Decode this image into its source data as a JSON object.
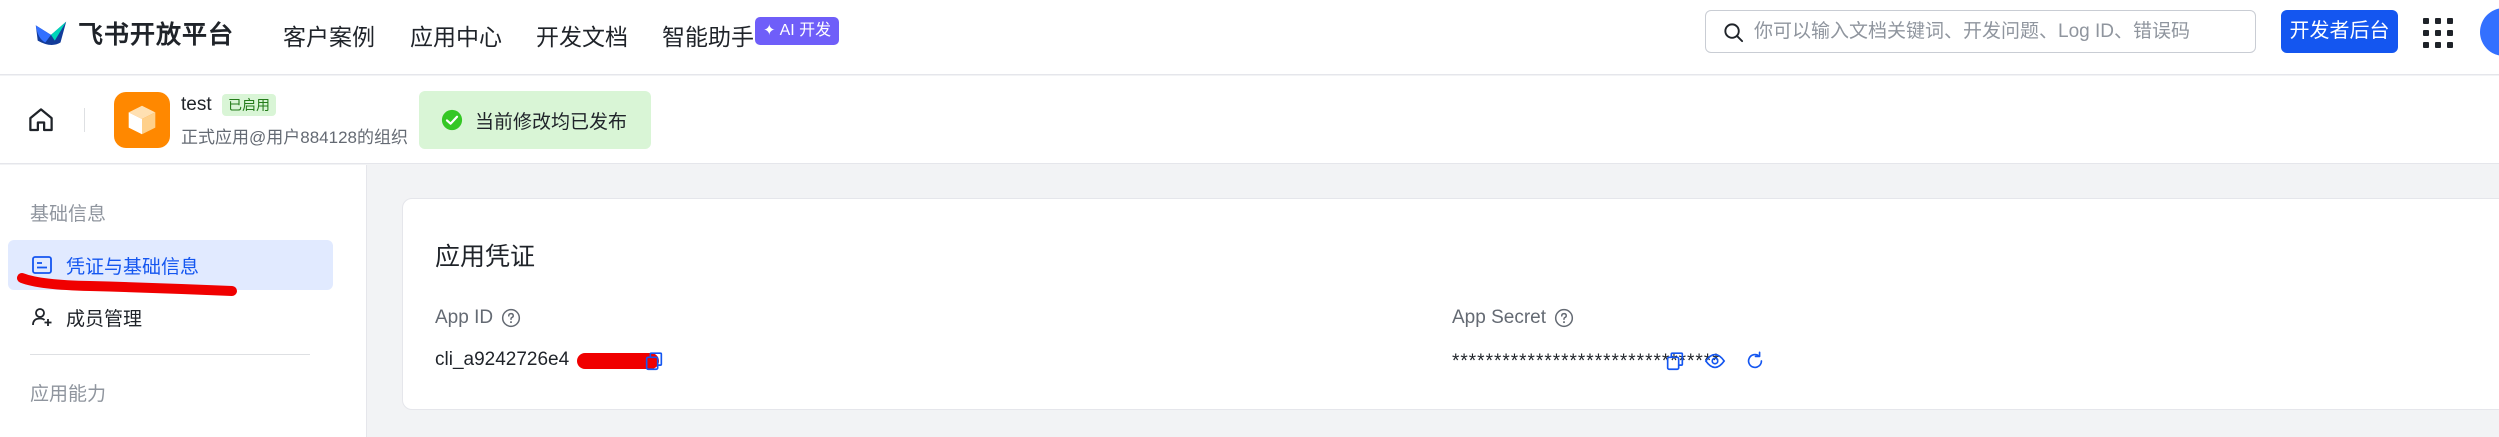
{
  "brand": {
    "name": "飞书开放平台"
  },
  "nav": {
    "items": [
      "客户案例",
      "应用中心",
      "开发文档",
      "智能助手"
    ],
    "ai_badge": "AI 开发"
  },
  "search": {
    "placeholder": "你可以输入文档关键词、开发问题、Log ID、错误码"
  },
  "header_actions": {
    "developer_console": "开发者后台"
  },
  "app": {
    "name": "test",
    "status": "已启用",
    "owner": "正式应用@用户884128的组织",
    "publish_status": "当前修改均已发布"
  },
  "sidebar": {
    "groups": [
      {
        "title": "基础信息",
        "items": [
          {
            "label": "凭证与基础信息",
            "active": true,
            "icon": "credential-icon"
          },
          {
            "label": "成员管理",
            "active": false,
            "icon": "user-add-icon"
          }
        ]
      },
      {
        "title": "应用能力",
        "items": []
      }
    ]
  },
  "credentials": {
    "title": "应用凭证",
    "app_id_label": "App ID",
    "app_id_value": "cli_a9242726e4",
    "app_secret_label": "App Secret",
    "app_secret_value": "********************************"
  },
  "colors": {
    "primary": "#1456f0",
    "success_bg": "#d9f5d6",
    "redaction": "#f00000",
    "app_icon": "#ff8800"
  }
}
